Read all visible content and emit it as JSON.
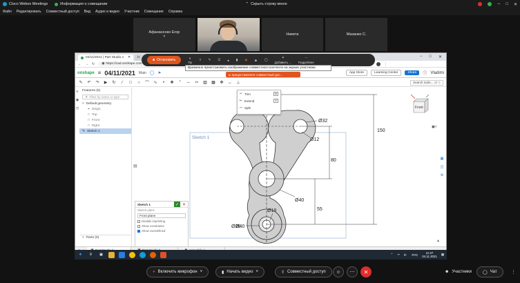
{
  "titlebar": {
    "app_name": "Cisco Webex Meetings",
    "meeting_info": "Информация о совещании",
    "hide_menu": "Скрыть строку меню",
    "colors": {
      "red": "#e02d2d",
      "green": "#2db84d"
    }
  },
  "menubar": [
    "Файл",
    "Редактировать",
    "Совместный доступ",
    "Вид",
    "Аудио и видео",
    "Участник",
    "Совещание",
    "Справка"
  ],
  "participants": [
    {
      "name": "Афанасенко Егор",
      "sub": "˅"
    },
    {
      "name": "",
      "video": true
    },
    {
      "name": "Никита",
      "sub": ""
    },
    {
      "name": "Мазанко С.",
      "sub": ""
    }
  ],
  "share_toolbar": {
    "stop_label": "Остановить",
    "icons": [
      "⏸",
      "⇧",
      "✎",
      "☰",
      "🎙",
      "🎥",
      "◉",
      "☺",
      "☺",
      "⭘",
      "⋯"
    ],
    "labels": [
      "Пр",
      "",
      "",
      "",
      "",
      "",
      "",
      "",
      "",
      "Добавить ...",
      "Подробнее"
    ]
  },
  "tooltip": "Временно приостановить изображение совместного контента на экране участника",
  "pause_bar": "ы предоставляете совместный дос...",
  "browser": {
    "tabs": [
      "04/11/2021 | Part Studio 1",
      "Н"
    ],
    "url": "https://cad.onshape.com",
    "window_controls": [
      "−",
      "□",
      "✕"
    ]
  },
  "onshape": {
    "logo": "onshape",
    "doc_title": "04/11/2021",
    "branch": "Main",
    "app_store": "App Store",
    "learning_center": "Learning Center",
    "share": "Share",
    "user": "Vladimi",
    "search_tools": "Search tools...",
    "search_kbd": "alt C",
    "accent": "#1673d3"
  },
  "features": {
    "header": "Features (5)",
    "filter_placeholder": "Filter by name or type",
    "default_geometry": "Default geometry",
    "items": [
      "Origin",
      "Top",
      "Front",
      "Right"
    ],
    "sketch": "Sketch 1",
    "parts": "Parts (0)"
  },
  "sketch_panel": {
    "title": "Sketch 1",
    "plane_label": "Sketch plane",
    "plane_value": "Front plane",
    "options": [
      "Disable imprinting",
      "Show constraints",
      "Show overdefined"
    ],
    "checked": [
      false,
      false,
      true
    ]
  },
  "trim_menu": [
    {
      "label": "Trim",
      "kbd": "M"
    },
    {
      "label": "Extend",
      "kbd": "E"
    },
    {
      "label": "Split",
      "kbd": ""
    }
  ],
  "viewcube_label": "Front",
  "drawing": {
    "sketch_label": "Sketch 1",
    "dims": {
      "d32": "Ø32",
      "d12": "Ø12",
      "d150": "150",
      "d80": "80",
      "d40": "Ø40",
      "d55": "55",
      "d18": "Ø18",
      "d26": "Ø26",
      "d40b": "Ø40"
    }
  },
  "bottom_tabs": [
    "Part Studio 1",
    "Part Studio 2",
    "Assembly 1"
  ],
  "taskbar": {
    "lang": "РУС",
    "time": "11:27",
    "date": "04.11.2021"
  },
  "webex_bottom": {
    "mic": "Включить микрофон",
    "video": "Начать видео",
    "share": "Совместный доступ",
    "participants": "Участники",
    "chat": "Чат"
  }
}
